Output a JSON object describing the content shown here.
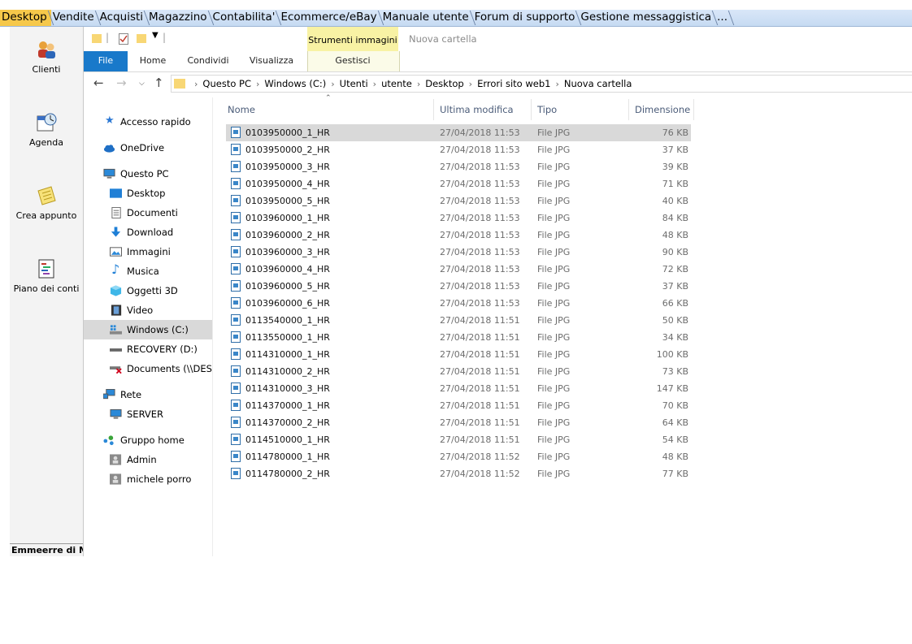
{
  "app_tabs": [
    "Desktop",
    "Vendite",
    "Acquisti",
    "Magazzino",
    "Contabilita'",
    "Ecommerce/eBay",
    "Manuale utente",
    "Forum di supporto",
    "Gestione messaggistica",
    "..."
  ],
  "launcher": {
    "items": [
      {
        "label": "Clienti",
        "icon": "clients-icon"
      },
      {
        "label": "Agenda",
        "icon": "calendar-icon"
      },
      {
        "label": "Crea appunto",
        "icon": "note-icon"
      },
      {
        "label": "Piano dei conti",
        "icon": "chart-of-accounts-icon"
      }
    ],
    "footer": "Emmeerre di Mic"
  },
  "explorer": {
    "context_tab": "Strumenti immagini",
    "window_title": "Nuova cartella",
    "ribbon_tabs": [
      "File",
      "Home",
      "Condividi",
      "Visualizza",
      "Gestisci"
    ],
    "breadcrumb": [
      "Questo PC",
      "Windows (C:)",
      "Utenti",
      "utente",
      "Desktop",
      "Errori sito web1",
      "Nuova cartella"
    ],
    "nav": [
      {
        "label": "Accesso rapido",
        "icon": "star-icon"
      },
      {
        "label": "OneDrive",
        "icon": "cloud-icon"
      },
      {
        "label": "Questo PC",
        "icon": "computer-icon"
      },
      {
        "label": "Desktop",
        "icon": "desktop-folder-icon"
      },
      {
        "label": "Documenti",
        "icon": "documents-icon"
      },
      {
        "label": "Download",
        "icon": "download-arrow-icon"
      },
      {
        "label": "Immagini",
        "icon": "pictures-icon"
      },
      {
        "label": "Musica",
        "icon": "music-note-icon"
      },
      {
        "label": "Oggetti 3D",
        "icon": "cube-icon"
      },
      {
        "label": "Video",
        "icon": "film-icon"
      },
      {
        "label": "Windows (C:)",
        "icon": "drive-icon"
      },
      {
        "label": "RECOVERY (D:)",
        "icon": "drive-icon"
      },
      {
        "label": "Documents (\\\\DESK",
        "icon": "network-drive-disconnected-icon"
      },
      {
        "label": "Rete",
        "icon": "network-icon"
      },
      {
        "label": "SERVER",
        "icon": "computer-icon"
      },
      {
        "label": "Gruppo home",
        "icon": "homegroup-icon"
      },
      {
        "label": "Admin",
        "icon": "user-icon"
      },
      {
        "label": "michele porro",
        "icon": "user-icon"
      }
    ],
    "columns": {
      "name": "Nome",
      "date": "Ultima modifica",
      "type": "Tipo",
      "size": "Dimensione"
    },
    "files": [
      {
        "name": "0103950000_1_HR",
        "date": "27/04/2018 11:53",
        "type": "File JPG",
        "size": "76 KB"
      },
      {
        "name": "0103950000_2_HR",
        "date": "27/04/2018 11:53",
        "type": "File JPG",
        "size": "37 KB"
      },
      {
        "name": "0103950000_3_HR",
        "date": "27/04/2018 11:53",
        "type": "File JPG",
        "size": "39 KB"
      },
      {
        "name": "0103950000_4_HR",
        "date": "27/04/2018 11:53",
        "type": "File JPG",
        "size": "71 KB"
      },
      {
        "name": "0103950000_5_HR",
        "date": "27/04/2018 11:53",
        "type": "File JPG",
        "size": "40 KB"
      },
      {
        "name": "0103960000_1_HR",
        "date": "27/04/2018 11:53",
        "type": "File JPG",
        "size": "84 KB"
      },
      {
        "name": "0103960000_2_HR",
        "date": "27/04/2018 11:53",
        "type": "File JPG",
        "size": "48 KB"
      },
      {
        "name": "0103960000_3_HR",
        "date": "27/04/2018 11:53",
        "type": "File JPG",
        "size": "90 KB"
      },
      {
        "name": "0103960000_4_HR",
        "date": "27/04/2018 11:53",
        "type": "File JPG",
        "size": "72 KB"
      },
      {
        "name": "0103960000_5_HR",
        "date": "27/04/2018 11:53",
        "type": "File JPG",
        "size": "37 KB"
      },
      {
        "name": "0103960000_6_HR",
        "date": "27/04/2018 11:53",
        "type": "File JPG",
        "size": "66 KB"
      },
      {
        "name": "0113540000_1_HR",
        "date": "27/04/2018 11:51",
        "type": "File JPG",
        "size": "50 KB"
      },
      {
        "name": "0113550000_1_HR",
        "date": "27/04/2018 11:51",
        "type": "File JPG",
        "size": "34 KB"
      },
      {
        "name": "0114310000_1_HR",
        "date": "27/04/2018 11:51",
        "type": "File JPG",
        "size": "100 KB"
      },
      {
        "name": "0114310000_2_HR",
        "date": "27/04/2018 11:51",
        "type": "File JPG",
        "size": "73 KB"
      },
      {
        "name": "0114310000_3_HR",
        "date": "27/04/2018 11:51",
        "type": "File JPG",
        "size": "147 KB"
      },
      {
        "name": "0114370000_1_HR",
        "date": "27/04/2018 11:51",
        "type": "File JPG",
        "size": "70 KB"
      },
      {
        "name": "0114370000_2_HR",
        "date": "27/04/2018 11:51",
        "type": "File JPG",
        "size": "64 KB"
      },
      {
        "name": "0114510000_1_HR",
        "date": "27/04/2018 11:51",
        "type": "File JPG",
        "size": "54 KB"
      },
      {
        "name": "0114780000_1_HR",
        "date": "27/04/2018 11:52",
        "type": "File JPG",
        "size": "48 KB"
      },
      {
        "name": "0114780000_2_HR",
        "date": "27/04/2018 11:52",
        "type": "File JPG",
        "size": "77 KB"
      }
    ]
  },
  "colors": {
    "active_tab": "#f6c84a",
    "file_tab": "#1979ca",
    "context_tab": "#f8f2a4",
    "row_highlight": "#d9d9d9"
  }
}
